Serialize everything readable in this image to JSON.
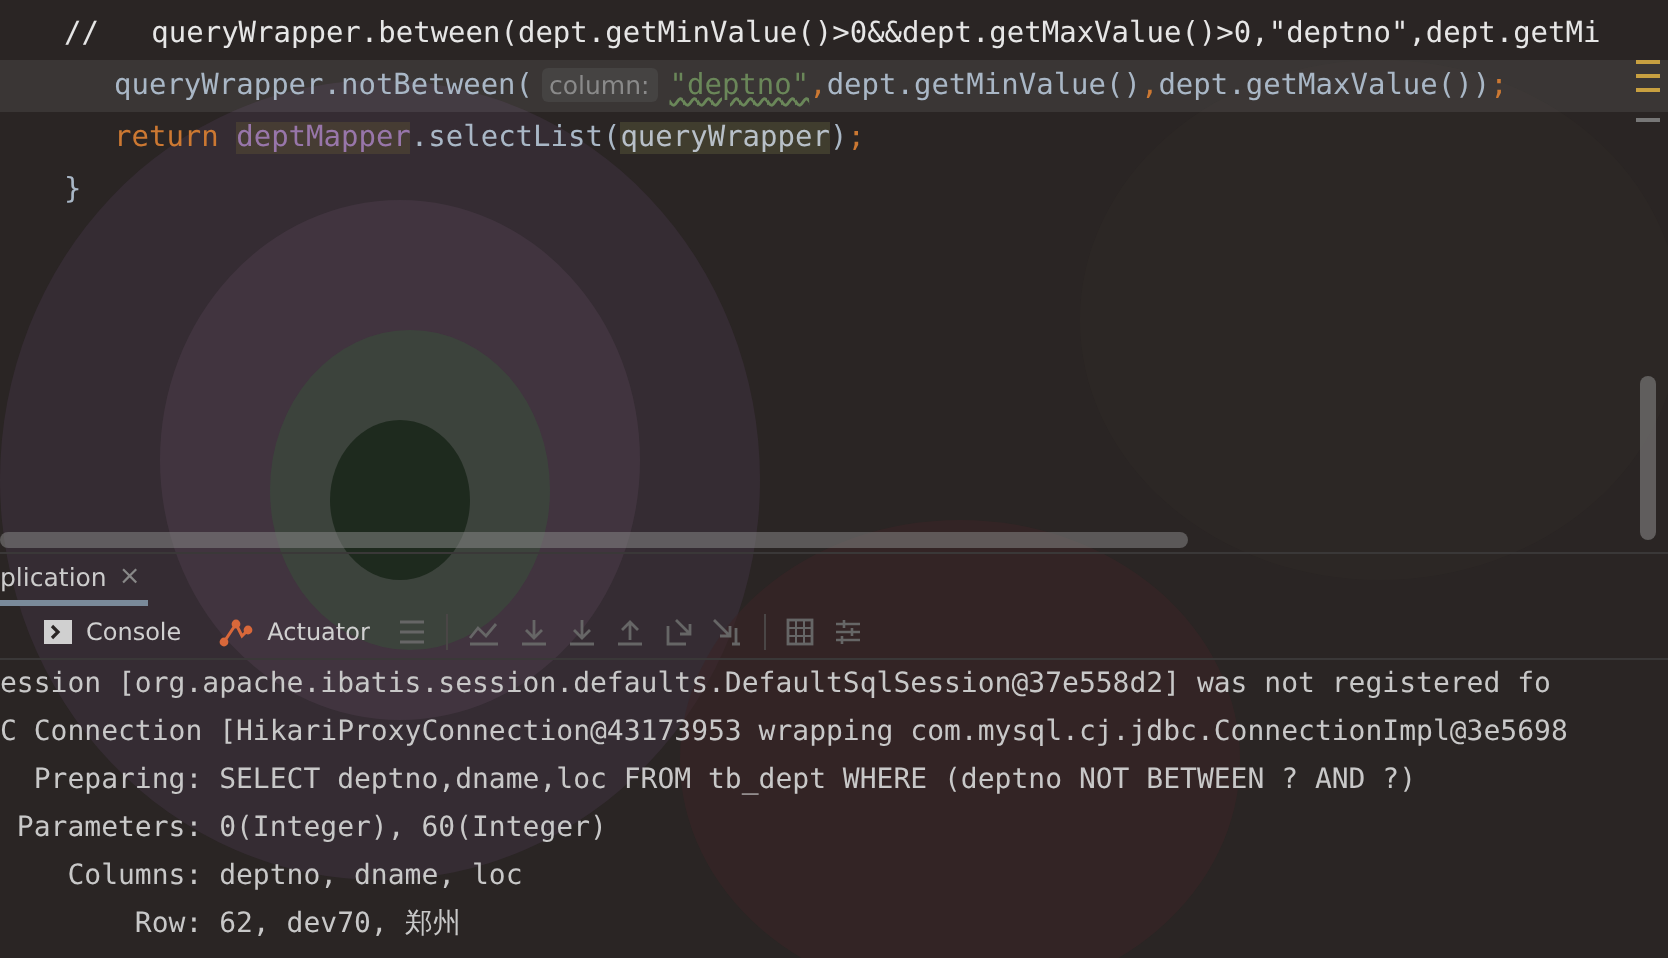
{
  "editor": {
    "lines": [
      {
        "kind": "top",
        "segments": [
          {
            "kind": "plain",
            "text": "//   queryWrapper.between(dept.getMinValue()>0&&dept.getMaxValue()>0,\"deptno\",dept.getMi"
          }
        ]
      },
      {
        "kind": "nested",
        "current": true,
        "segments": [
          {
            "kind": "code",
            "text": "queryWrapper.notBetween("
          },
          {
            "kind": "hint",
            "text": "column:"
          },
          {
            "kind": "string",
            "text": "\"deptno\""
          },
          {
            "kind": "keyword",
            "text": ","
          },
          {
            "kind": "code",
            "text": "dept.getMinValue()"
          },
          {
            "kind": "keyword",
            "text": ","
          },
          {
            "kind": "code",
            "text": "dept.getMaxValue())"
          },
          {
            "kind": "keyword",
            "text": ";"
          }
        ]
      },
      {
        "kind": "nested",
        "segments": [
          {
            "kind": "keyword",
            "text": "return "
          },
          {
            "kind": "field",
            "text": "deptMapper"
          },
          {
            "kind": "code",
            "text": ".selectList("
          },
          {
            "kind": "ref",
            "text": "queryWrapper"
          },
          {
            "kind": "code",
            "text": ")"
          },
          {
            "kind": "keyword",
            "text": ";"
          }
        ]
      },
      {
        "kind": "top",
        "segments": [
          {
            "kind": "code",
            "text": "}"
          }
        ]
      }
    ]
  },
  "run_panel": {
    "tabs": [
      {
        "label": "plication",
        "close": "×",
        "selected": true
      }
    ],
    "toolbar": [
      {
        "label": "Console",
        "kind": "console"
      },
      {
        "label": "Actuator",
        "kind": "actuator"
      }
    ],
    "console": [
      "ession [org.apache.ibatis.session.defaults.DefaultSqlSession@37e558d2] was not registered fo",
      "C Connection [HikariProxyConnection@43173953 wrapping com.mysql.cj.jdbc.ConnectionImpl@3e5698",
      "  Preparing: SELECT deptno,dname,loc FROM tb_dept WHERE (deptno NOT BETWEEN ? AND ?)",
      " Parameters: 0(Integer), 60(Integer)",
      "    Columns: deptno, dname, loc",
      "        Row: 62, dev70, 郑州"
    ]
  }
}
